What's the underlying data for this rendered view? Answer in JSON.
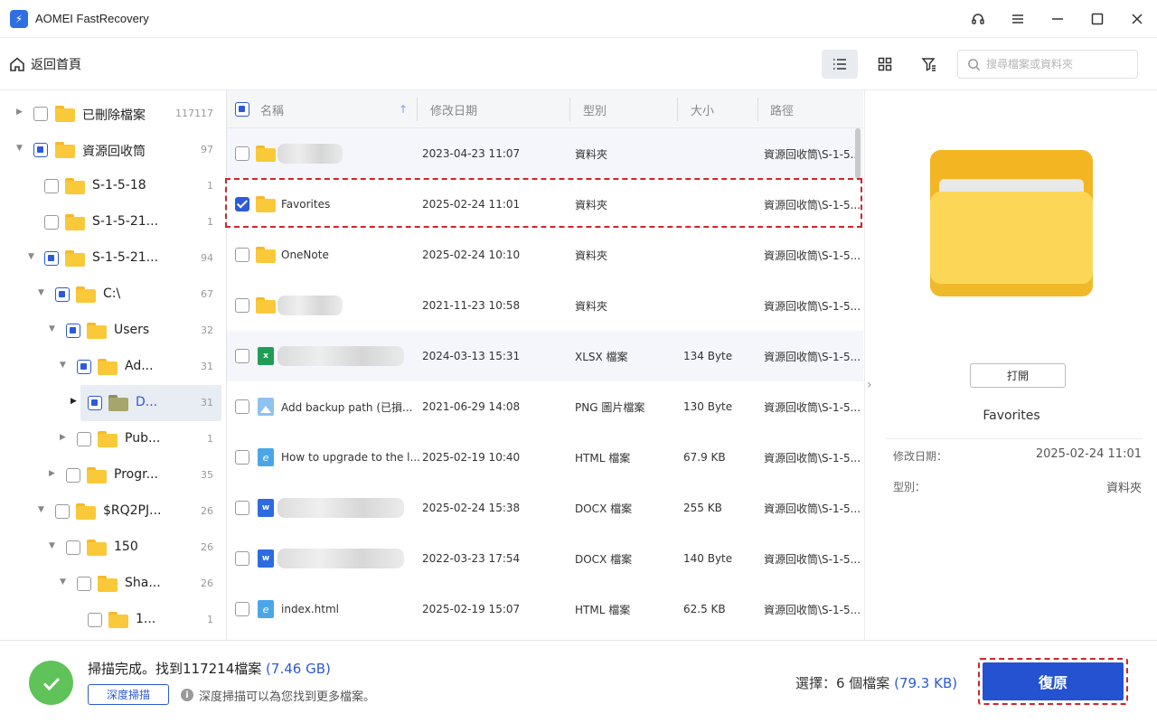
{
  "app": {
    "title": "AOMEI FastRecovery"
  },
  "toolbar": {
    "home_label": "返回首頁",
    "search_placeholder": "搜尋檔案或資料夾"
  },
  "tree": [
    {
      "label": "已刪除檔案",
      "count": "117117",
      "check": "none",
      "expand": "collapsed",
      "level": 0,
      "icon": "trash-folder"
    },
    {
      "label": "資源回收筒",
      "count": "97",
      "check": "partial",
      "expand": "expanded",
      "level": 0,
      "icon": "recycle-folder"
    },
    {
      "label": "S-1-5-18",
      "count": "1",
      "check": "none",
      "expand": "none",
      "level": 1
    },
    {
      "label": "S-1-5-21...",
      "count": "1",
      "check": "none",
      "expand": "none",
      "level": 1
    },
    {
      "label": "S-1-5-21...",
      "count": "94",
      "check": "partial",
      "expand": "expanded",
      "level": 1
    },
    {
      "label": "C:\\",
      "count": "67",
      "check": "partial",
      "expand": "expanded",
      "level": 2
    },
    {
      "label": "Users",
      "count": "32",
      "check": "partial",
      "expand": "expanded",
      "level": 3
    },
    {
      "label": "Ad...",
      "count": "31",
      "check": "partial",
      "expand": "expanded",
      "level": 4
    },
    {
      "label": "D...",
      "count": "31",
      "check": "partial",
      "expand": "collapsed-dark",
      "level": 5,
      "selected": true
    },
    {
      "label": "Pub...",
      "count": "1",
      "check": "none",
      "expand": "collapsed",
      "level": 4
    },
    {
      "label": "Progr...",
      "count": "35",
      "check": "none",
      "expand": "collapsed",
      "level": 3
    },
    {
      "label": "$RQ2PJ...",
      "count": "26",
      "check": "none",
      "expand": "expanded",
      "level": 2
    },
    {
      "label": "150",
      "count": "26",
      "check": "none",
      "expand": "expanded",
      "level": 3
    },
    {
      "label": "Sha...",
      "count": "26",
      "check": "none",
      "expand": "expanded",
      "level": 4
    },
    {
      "label": "1...",
      "count": "1",
      "check": "none",
      "expand": "none",
      "level": 5
    }
  ],
  "list": {
    "columns": [
      "名稱",
      "修改日期",
      "型別",
      "大小",
      "路徑"
    ],
    "rows": [
      {
        "name": "",
        "date": "2023-04-23 11:07",
        "type": "資料夾",
        "size": "",
        "path": "資源回收筒\\S-1-5...",
        "icon": "folder",
        "blurred": true,
        "checked": false
      },
      {
        "name": "Favorites",
        "date": "2025-02-24 11:01",
        "type": "資料夾",
        "size": "",
        "path": "資源回收筒\\S-1-5...",
        "icon": "folder",
        "blurred": false,
        "checked": true
      },
      {
        "name": "OneNote",
        "date": "2025-02-24 10:10",
        "type": "資料夾",
        "size": "",
        "path": "資源回收筒\\S-1-5...",
        "icon": "folder",
        "blurred": false,
        "checked": false
      },
      {
        "name": "",
        "date": "2021-11-23 10:58",
        "type": "資料夾",
        "size": "",
        "path": "資源回收筒\\S-1-5...",
        "icon": "folder",
        "blurred": true,
        "checked": false
      },
      {
        "name": "",
        "date": "2024-03-13 15:31",
        "type": "XLSX 檔案",
        "size": "134 Byte",
        "path": "資源回收筒\\S-1-5...",
        "icon": "xlsx",
        "blurred": true,
        "checked": false
      },
      {
        "name": "Add backup path (已損...",
        "date": "2021-06-29 14:08",
        "type": "PNG 圖片檔案",
        "size": "130 Byte",
        "path": "資源回收筒\\S-1-5...",
        "icon": "png",
        "blurred": false,
        "checked": false
      },
      {
        "name": "How to upgrade to the l...",
        "date": "2025-02-19 10:40",
        "type": "HTML 檔案",
        "size": "67.9 KB",
        "path": "資源回收筒\\S-1-5...",
        "icon": "html",
        "blurred": false,
        "checked": false
      },
      {
        "name": "",
        "date": "2025-02-24 15:38",
        "type": "DOCX 檔案",
        "size": "255 KB",
        "path": "資源回收筒\\S-1-5...",
        "icon": "docx",
        "blurred": true,
        "checked": false
      },
      {
        "name": "",
        "date": "2022-03-23 17:54",
        "type": "DOCX 檔案",
        "size": "140 Byte",
        "path": "資源回收筒\\S-1-5...",
        "icon": "docx",
        "blurred": true,
        "checked": false
      },
      {
        "name": "index.html",
        "date": "2025-02-19 15:07",
        "type": "HTML 檔案",
        "size": "62.5 KB",
        "path": "資源回收筒\\S-1-5...",
        "icon": "html",
        "blurred": false,
        "checked": false
      }
    ]
  },
  "preview": {
    "open_label": "打開",
    "name": "Favorites",
    "modified_label": "修改日期：",
    "modified_value": "2025-02-24 11:01",
    "type_label": "型別：",
    "type_value": "資料夾"
  },
  "status": {
    "scan_done": "掃描完成。找到117214檔案",
    "scan_size": "(7.46 GB)",
    "deep_scan_label": "深度掃描",
    "hint": "深度掃描可以為您找到更多檔案。",
    "selected_text": "選擇：6 個檔案",
    "selected_size": "(79.3 KB)",
    "restore_label": "復原"
  }
}
